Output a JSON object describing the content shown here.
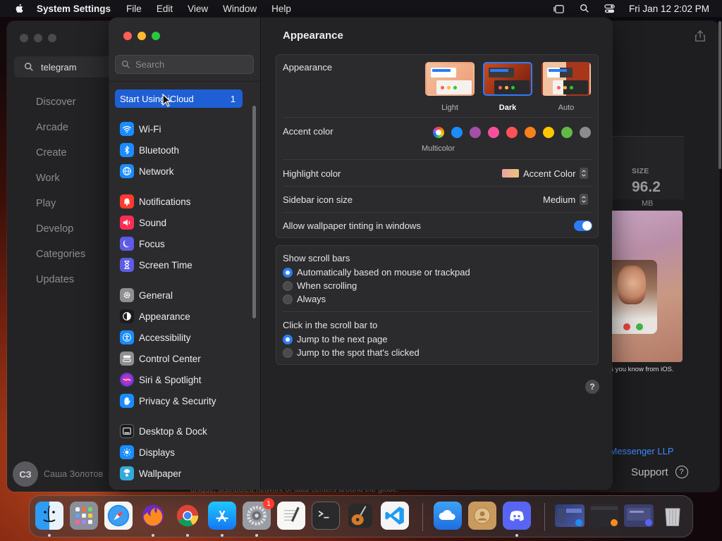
{
  "menubar": {
    "app_name": "System Settings",
    "items": [
      "File",
      "Edit",
      "View",
      "Window",
      "Help"
    ],
    "datetime": "Fri Jan 12  2:02 PM"
  },
  "appstore": {
    "search_value": "telegram",
    "nav": [
      "Discover",
      "Arcade",
      "Create",
      "Work",
      "Play",
      "Develop",
      "Categories",
      "Updates"
    ],
    "user_initials": "СЗ",
    "user_name": "Саша Золотов",
    "size_label": "SIZE",
    "size_value": "96.2",
    "size_unit": "MB",
    "caption": "es you know from iOS.",
    "developer": "m Messenger LLP",
    "support": "Support",
    "support_icon": "?",
    "footer_text": "unique, distributed network of data centers around the globe."
  },
  "settings": {
    "search_placeholder": "Search",
    "icloud_label": "Start Using iCloud",
    "icloud_badge": "1",
    "sidebar": [
      {
        "label": "Wi-Fi",
        "icon": "wifi-icon",
        "color": "#1a8cff"
      },
      {
        "label": "Bluetooth",
        "icon": "bluetooth-icon",
        "color": "#1a8cff"
      },
      {
        "label": "Network",
        "icon": "globe-icon",
        "color": "#1a8cff"
      },
      {
        "label": "Notifications",
        "icon": "bell-icon",
        "color": "#ff3b30"
      },
      {
        "label": "Sound",
        "icon": "speaker-icon",
        "color": "#ff2d55"
      },
      {
        "label": "Focus",
        "icon": "moon-icon",
        "color": "#5e5ce6"
      },
      {
        "label": "Screen Time",
        "icon": "hourglass-icon",
        "color": "#5e5ce6"
      },
      {
        "label": "General",
        "icon": "gear-icon",
        "color": "#8e8e93"
      },
      {
        "label": "Appearance",
        "icon": "appearance-icon",
        "color": "#1c1c1e"
      },
      {
        "label": "Accessibility",
        "icon": "accessibility-icon",
        "color": "#1a8cff"
      },
      {
        "label": "Control Center",
        "icon": "control-center-icon",
        "color": "#8e8e93"
      },
      {
        "label": "Siri & Spotlight",
        "icon": "siri-icon",
        "color": "#a04fe0"
      },
      {
        "label": "Privacy & Security",
        "icon": "hand-icon",
        "color": "#1a8cff"
      },
      {
        "label": "Desktop & Dock",
        "icon": "dock-icon",
        "color": "#1c1c1e"
      },
      {
        "label": "Displays",
        "icon": "sun-icon",
        "color": "#1a8cff"
      },
      {
        "label": "Wallpaper",
        "icon": "wallpaper-icon",
        "color": "#34aadc"
      }
    ],
    "title": "Appearance",
    "appearance_label": "Appearance",
    "themes": [
      {
        "label": "Light",
        "selected": false
      },
      {
        "label": "Dark",
        "selected": true
      },
      {
        "label": "Auto",
        "selected": false
      }
    ],
    "accent_label": "Accent color",
    "accent_colors": [
      "multicolor",
      "#1a8cff",
      "#a550a7",
      "#f74f9e",
      "#ff5257",
      "#f7821b",
      "#ffc600",
      "#62ba46",
      "#8c8c8c"
    ],
    "multicolor_label": "Multicolor",
    "highlight_label": "Highlight color",
    "highlight_value": "Accent Color",
    "icon_size_label": "Sidebar icon size",
    "icon_size_value": "Medium",
    "tinting_label": "Allow wallpaper tinting in windows",
    "tinting_on": true,
    "scrollbars_label": "Show scroll bars",
    "scrollbar_options": [
      {
        "label": "Automatically based on mouse or trackpad",
        "selected": true
      },
      {
        "label": "When scrolling",
        "selected": false
      },
      {
        "label": "Always",
        "selected": false
      }
    ],
    "click_label": "Click in the scroll bar to",
    "click_options": [
      {
        "label": "Jump to the next page",
        "selected": true
      },
      {
        "label": "Jump to the spot that's clicked",
        "selected": false
      }
    ],
    "help_icon": "?"
  },
  "dock": {
    "apps": [
      {
        "name": "finder-icon",
        "running": true
      },
      {
        "name": "launchpad-icon",
        "running": false
      },
      {
        "name": "safari-icon",
        "running": false
      },
      {
        "name": "firefox-icon",
        "running": true
      },
      {
        "name": "chrome-icon",
        "running": true
      },
      {
        "name": "app-store-icon",
        "running": true
      },
      {
        "name": "system-settings-icon",
        "running": true,
        "badge": "1"
      },
      {
        "name": "textedit-icon",
        "running": false
      },
      {
        "name": "terminal-icon",
        "running": false
      },
      {
        "name": "garageband-icon",
        "running": false
      },
      {
        "name": "vscode-icon",
        "running": false
      },
      {
        "name": "weather-icon",
        "running": false
      },
      {
        "name": "contacts-icon",
        "running": false
      },
      {
        "name": "discord-icon",
        "running": true
      }
    ]
  }
}
